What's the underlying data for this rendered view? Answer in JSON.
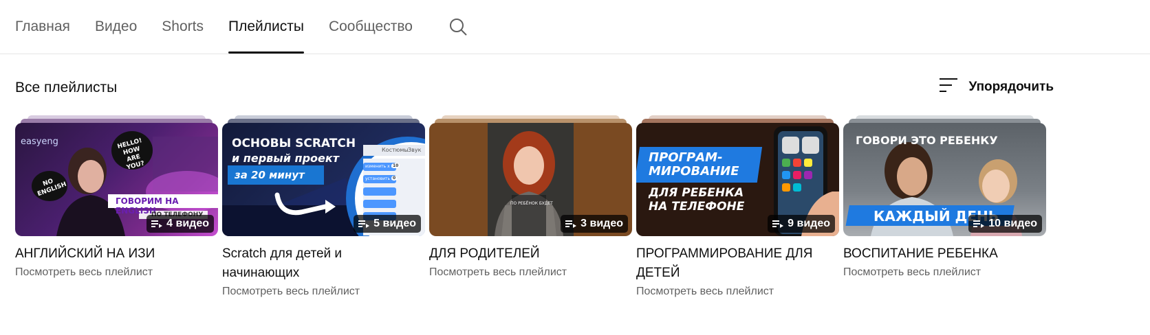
{
  "tabs": [
    {
      "label": "Главная"
    },
    {
      "label": "Видео"
    },
    {
      "label": "Shorts"
    },
    {
      "label": "Плейлисты"
    },
    {
      "label": "Сообщество"
    }
  ],
  "active_tab": "Плейлисты",
  "section_title": "Все плейлисты",
  "sort_label": "Упорядочить",
  "playlists": [
    {
      "title": "АНГЛИЙСКИЙ НА ИЗИ",
      "count": "4 видео",
      "link": "Посмотреть весь плейлист",
      "thumb_text": {
        "brand": "easyeng",
        "bubble": "HELLO! HOW ARE YOU?",
        "bubble2": "NO ENGLISH",
        "banner": "ГОВОРИМ НА ENGLISH",
        "sub": "ПО ТЕЛЕФОНУ"
      }
    },
    {
      "title": "Scratch для детей и начинающих",
      "count": "5 видео",
      "link": "Посмотреть весь плейлист",
      "thumb_text": {
        "line1": "ОСНОВЫ SCRATCH",
        "line2": "и первый проект",
        "line3": "за 20 минут",
        "panel": "Костюмы",
        "panel2": "Звук",
        "block": "изменить х на",
        "block_val": "10",
        "block2": "установить х в",
        "block2_val": "0"
      }
    },
    {
      "title": "ДЛЯ РОДИТЕЛЕЙ",
      "count": "3 видео",
      "link": "Посмотреть весь плейлист",
      "thumb_text": {
        "caption": "ПО РЕБЁНОК БУДЕТ"
      }
    },
    {
      "title": "ПРОГРАММИРОВАНИЕ ДЛЯ ДЕТЕЙ",
      "count": "9 видео",
      "link": "Посмотреть весь плейлист",
      "thumb_text": {
        "line1": "ПРОГРАМ-",
        "line2": "МИРОВАНИЕ",
        "line3": "ДЛЯ РЕБЕНКА",
        "line4": "НА ТЕЛЕФОНЕ"
      }
    },
    {
      "title": "ВОСПИТАНИЕ РЕБЕНКА",
      "count": "10 видео",
      "link": "Посмотреть весь плейлист",
      "thumb_text": {
        "top": "ГОВОРИ ЭТО РЕБЕНКУ",
        "bottom": "КАЖДЫЙ ДЕНЬ"
      }
    }
  ]
}
